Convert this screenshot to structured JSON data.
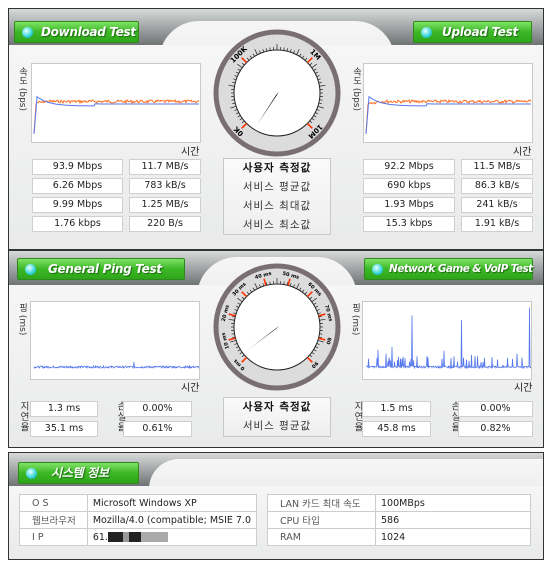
{
  "speed": {
    "download": {
      "title": "Download Test",
      "y_label": "속도 (bps)",
      "x_label": "시간",
      "rows": [
        [
          "93.9 Mbps",
          "11.7 MB/s"
        ],
        [
          "6.26 Mbps",
          "783 kB/s"
        ],
        [
          "9.99 Mbps",
          "1.25 MB/s"
        ],
        [
          "1.76 kbps",
          "220 B/s"
        ]
      ]
    },
    "upload": {
      "title": "Upload Test",
      "y_label": "속도 (bps)",
      "x_label": "시간",
      "rows": [
        [
          "92.2 Mbps",
          "11.5 MB/s"
        ],
        [
          "690 kbps",
          "86.3 kB/s"
        ],
        [
          "1.93 Mbps",
          "241 kB/s"
        ],
        [
          "15.3 kbps",
          "1.91 kB/s"
        ]
      ]
    },
    "center_labels": [
      "사용자 측정값",
      "서비스 평균값",
      "서비스 최대값",
      "서비스 최소값"
    ],
    "gauge_labels": [
      "0K",
      "100K",
      "1M",
      "10M"
    ],
    "series_colors": {
      "measured": "#ff6a1a",
      "average": "#5577ee"
    }
  },
  "ping": {
    "general": {
      "title": "General Ping Test",
      "y_label": "핑 (ms)",
      "x_label": "시간",
      "latency_label": "지연율",
      "loss_label": "손실율",
      "latency": [
        "1.3 ms",
        "35.1 ms"
      ],
      "loss": [
        "0.00%",
        "0.61%"
      ]
    },
    "game": {
      "title": "Network Game & VoIP Test",
      "y_label": "핑 (ms)",
      "x_label": "시간",
      "latency_label": "지연율",
      "loss_label": "손실율",
      "latency": [
        "1.5 ms",
        "45.8 ms"
      ],
      "loss": [
        "0.00%",
        "0.82%"
      ]
    },
    "center_labels": [
      "사용자 측정값",
      "서비스 평균값"
    ],
    "gauge_labels": [
      "0 ms",
      "10 ms",
      "20 ms",
      "30 ms",
      "40 ms",
      "50 ms",
      "60 ms",
      "70 ms",
      "80",
      "90"
    ]
  },
  "system": {
    "title": "시스템 정보",
    "left": [
      [
        "O S",
        "Microsoft Windows XP"
      ],
      [
        "웹브라우저",
        "Mozilla/4.0 (compatible; MSIE 7.0"
      ],
      [
        "I P",
        "61."
      ]
    ],
    "right": [
      [
        "LAN 카드 최대 속도",
        "100MBps"
      ],
      [
        "CPU 타입",
        "586"
      ],
      [
        "RAM",
        "1024"
      ]
    ]
  },
  "accent_green": "#3cb826",
  "gauge_marker": "#ff3300"
}
